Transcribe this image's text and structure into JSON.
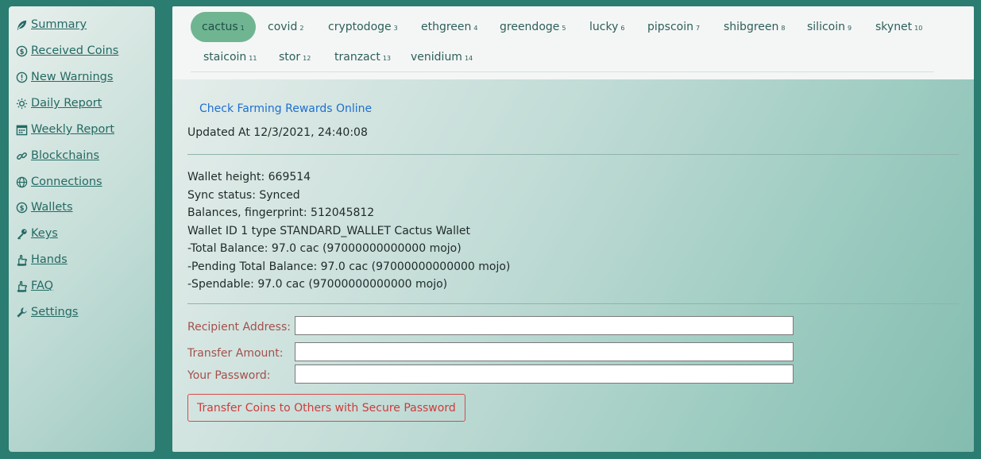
{
  "sidebar": {
    "items": [
      {
        "label": "Summary",
        "icon": "leaf-icon"
      },
      {
        "label": "Received Coins",
        "icon": "coin-icon"
      },
      {
        "label": "New Warnings",
        "icon": "warning-icon"
      },
      {
        "label": "Daily Report",
        "icon": "sun-icon"
      },
      {
        "label": "Weekly Report",
        "icon": "calendar-icon"
      },
      {
        "label": "Blockchains",
        "icon": "link-icon"
      },
      {
        "label": "Connections",
        "icon": "globe-icon"
      },
      {
        "label": "Wallets",
        "icon": "coin-icon"
      },
      {
        "label": "Keys",
        "icon": "key-icon"
      },
      {
        "label": "Hands",
        "icon": "hand-icon"
      },
      {
        "label": "FAQ",
        "icon": "hand-icon"
      },
      {
        "label": "Settings",
        "icon": "wrench-icon"
      }
    ]
  },
  "tabs": [
    {
      "label": "cactus",
      "num": "1",
      "active": true
    },
    {
      "label": "covid",
      "num": "2"
    },
    {
      "label": "cryptodoge",
      "num": "3"
    },
    {
      "label": "ethgreen",
      "num": "4"
    },
    {
      "label": "greendoge",
      "num": "5"
    },
    {
      "label": "lucky",
      "num": "6"
    },
    {
      "label": "pipscoin",
      "num": "7"
    },
    {
      "label": "shibgreen",
      "num": "8"
    },
    {
      "label": "silicoin",
      "num": "9"
    },
    {
      "label": "skynet",
      "num": "10"
    },
    {
      "label": "staicoin",
      "num": "11"
    },
    {
      "label": "stor",
      "num": "12"
    },
    {
      "label": "tranzact",
      "num": "13"
    },
    {
      "label": "venidium",
      "num": "14"
    }
  ],
  "main": {
    "rewards_link": "Check Farming Rewards Online",
    "updated": "Updated At 12/3/2021, 24:40:08",
    "wallet_lines": [
      "Wallet height: 669514",
      "Sync status: Synced",
      "Balances, fingerprint: 512045812",
      "Wallet ID 1 type STANDARD_WALLET Cactus Wallet",
      "-Total Balance: 97.0 cac (97000000000000 mojo)",
      "-Pending Total Balance: 97.0 cac (97000000000000 mojo)",
      "-Spendable: 97.0 cac (97000000000000 mojo)"
    ]
  },
  "form": {
    "recipient_label": "Recipient Address:",
    "recipient_value": "",
    "amount_label": "Transfer Amount:",
    "amount_value": "",
    "password_label": "Your Password:",
    "password_value": "",
    "submit_label": "Transfer Coins to Others with Secure Password"
  },
  "colors": {
    "page_bg": "#2b7c71",
    "active_tab": "#6fb592",
    "link": "#1e6fd0",
    "danger": "#cf3b3b"
  }
}
